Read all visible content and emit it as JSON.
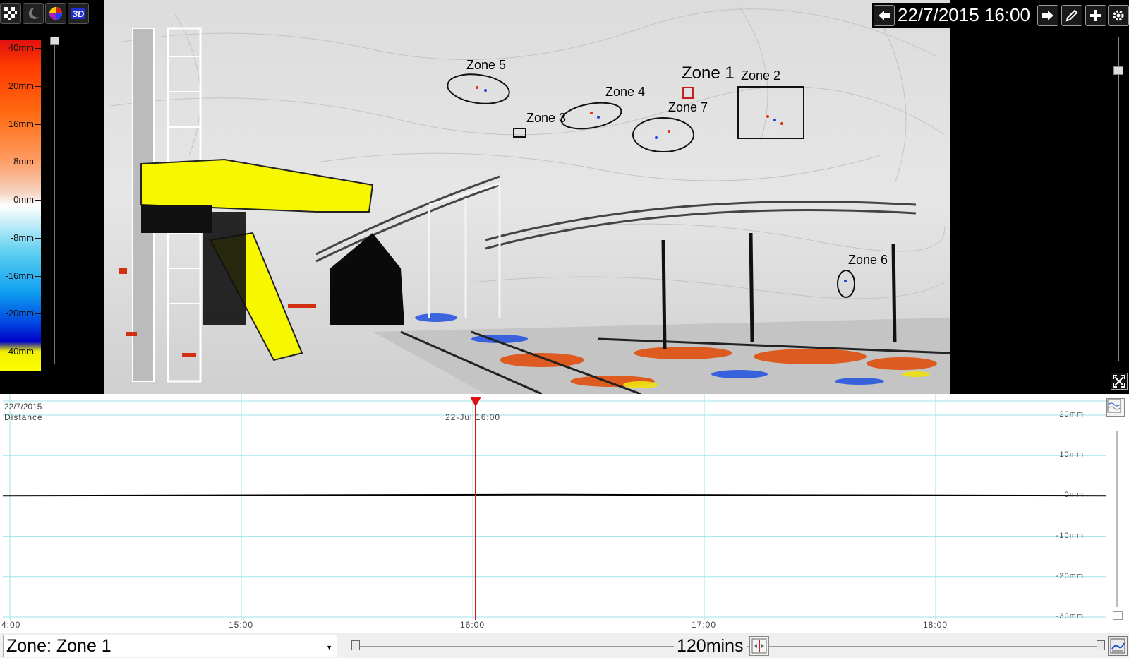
{
  "toolbar": {
    "icons": [
      "pattern-icon",
      "moon-icon",
      "color-palette-icon",
      "3d-view-icon"
    ],
    "view_3d_label": "3D"
  },
  "legend": {
    "labels": [
      "40mm",
      "20mm",
      "16mm",
      "8mm",
      "0mm",
      "-8mm",
      "-16mm",
      "-20mm",
      "-40mm"
    ]
  },
  "navigation": {
    "datetime": "22/7/2015 16:00",
    "icons": [
      "arrow-left-icon",
      "arrow-right-icon",
      "pencil-icon",
      "plus-icon",
      "gear-icon"
    ]
  },
  "zones": [
    {
      "id": "zone-1",
      "label": "Zone 1"
    },
    {
      "id": "zone-2",
      "label": "Zone 2"
    },
    {
      "id": "zone-3",
      "label": "Zone 3"
    },
    {
      "id": "zone-4",
      "label": "Zone 4"
    },
    {
      "id": "zone-5",
      "label": "Zone 5"
    },
    {
      "id": "zone-6",
      "label": "Zone 6"
    },
    {
      "id": "zone-7",
      "label": "Zone 7"
    }
  ],
  "graph": {
    "date": "22/7/2015",
    "metric": "Distance",
    "cursor_label": "22-Jul 16:00",
    "y_labels": [
      "20mm",
      "10mm",
      "0mm",
      "-10mm",
      "-20mm",
      "-30mm"
    ],
    "x_labels": [
      "4:00",
      "15:00",
      "16:00",
      "17:00",
      "18:00"
    ],
    "series_value_mm": 0.2
  },
  "bottom": {
    "zone_select": "Zone: Zone 1",
    "range_value": "120mins"
  },
  "colors": {
    "grid": "#9fe3ee",
    "cursor": "#e01010",
    "series": "#000000"
  }
}
